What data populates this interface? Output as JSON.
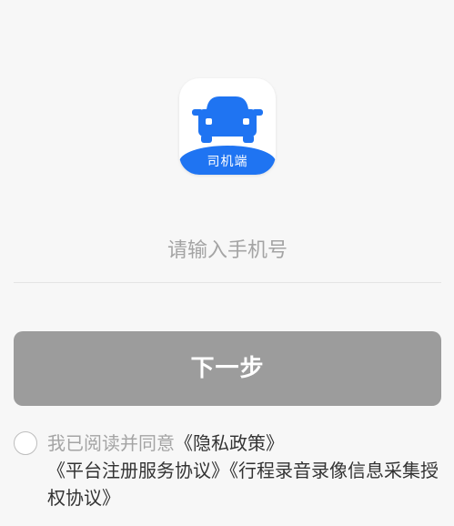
{
  "logo": {
    "badge_text": "司机端",
    "brand_color": "#1f74f2",
    "icon": "car-icon"
  },
  "phone": {
    "placeholder": "请输入手机号",
    "value": ""
  },
  "next_button": {
    "label": "下一步",
    "color": "#9c9c9c"
  },
  "agreement": {
    "checked": false,
    "prefix": "我已阅读并同意",
    "links": [
      "《隐私政策》",
      "《平台注册服务协议》",
      "《行程录音录像信息采集授权协议》"
    ]
  }
}
